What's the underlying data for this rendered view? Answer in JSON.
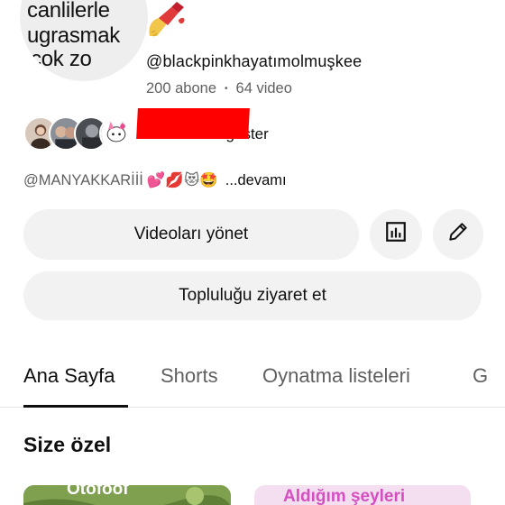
{
  "channel": {
    "avatar_text_lines": [
      "canlilerle",
      "ugrasmak",
      "cok    zo"
    ],
    "handle": "@blackpinkhayatımolmuşkee",
    "subscribers": "200 abone",
    "separator": "•",
    "videos": "64 video",
    "subscribers_link": "Aboneleri göster",
    "description": "@MANYAKKARİİİ",
    "description_emojis": "💕💋😻🤩",
    "description_more": "...devamı"
  },
  "actions": {
    "manage_videos": "Videoları yönet",
    "visit_community": "Topluluğu ziyaret et"
  },
  "tabs": [
    {
      "label": "Ana Sayfa",
      "active": true
    },
    {
      "label": "Shorts",
      "active": false
    },
    {
      "label": "Oynatma listeleri",
      "active": false
    },
    {
      "label": "G",
      "active": false
    }
  ],
  "section": {
    "title": "Size özel"
  },
  "thumbnails": [
    {
      "title": "Otofoof"
    },
    {
      "title": "Aldığım şeyleri"
    }
  ],
  "colors": {
    "text_primary": "#0f0f0f",
    "text_secondary": "#606060",
    "button_bg": "#f2f2f2",
    "redaction": "#ff0000"
  },
  "icons": {
    "channel_name": "nail-polish-emoji",
    "stats": "analytics-icon",
    "edit": "pencil-icon"
  }
}
